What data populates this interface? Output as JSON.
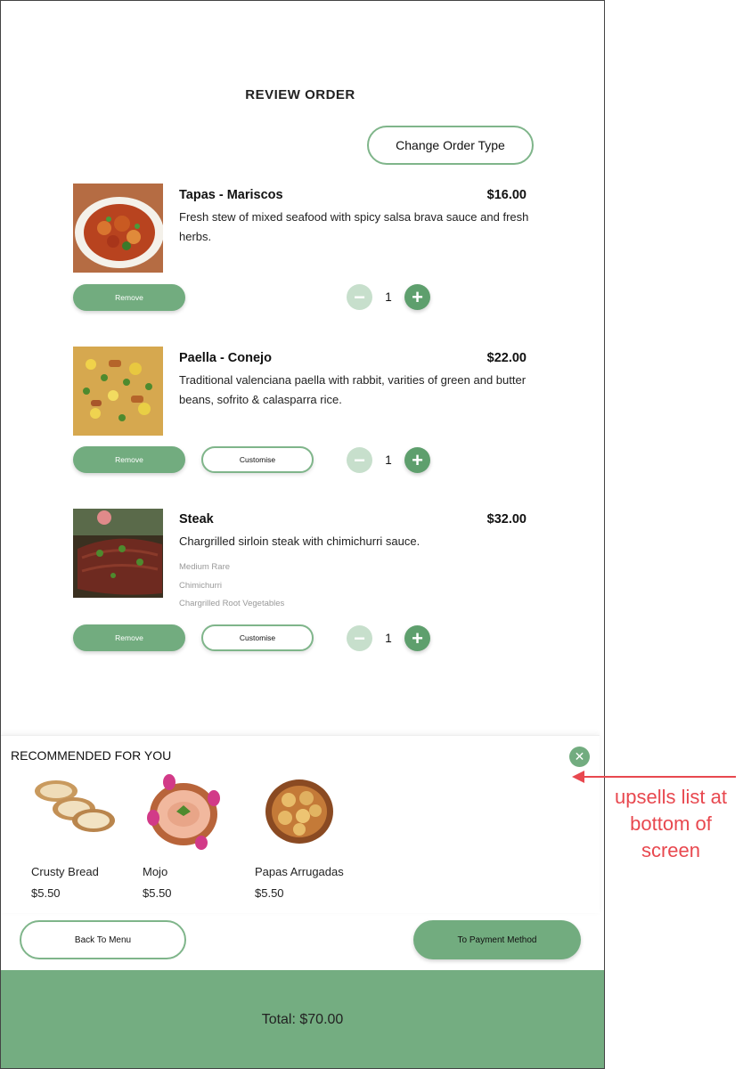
{
  "header": {
    "title": "REVIEW ORDER",
    "change_order_type_label": "Change Order Type"
  },
  "items": [
    {
      "name": "Tapas - Mariscos",
      "price": "$16.00",
      "description": "Fresh stew of mixed seafood with spicy salsa brava sauce and fresh herbs.",
      "remove_label": "Remove",
      "quantity": "1"
    },
    {
      "name": "Paella - Conejo",
      "price": "$22.00",
      "description": "Traditional valenciana paella with rabbit, varities of green and butter beans, sofrito & calasparra rice.",
      "remove_label": "Remove",
      "customise_label": "Customise",
      "quantity": "1"
    },
    {
      "name": "Steak",
      "price": "$32.00",
      "description": "Chargrilled sirloin steak with chimichurri sauce.",
      "modifiers": [
        "Medium Rare",
        "Chimichurri",
        "Chargrilled Root Vegetables"
      ],
      "remove_label": "Remove",
      "customise_label": "Customise",
      "quantity": "1"
    }
  ],
  "recommended": {
    "title": "RECOMMENDED FOR YOU",
    "items": [
      {
        "name": "Crusty Bread",
        "price": "$5.50"
      },
      {
        "name": "Mojo",
        "price": "$5.50"
      },
      {
        "name": "Papas Arrugadas",
        "price": "$5.50"
      }
    ]
  },
  "footer": {
    "back_label": "Back To Menu",
    "pay_label": "To Payment Method",
    "total_label": "Total: $70.00"
  },
  "annotation": {
    "lines": [
      "upsells list at",
      "bottom of",
      "screen"
    ]
  },
  "colors": {
    "accent": "#72ac7f",
    "accent_light": "#c7dfcc",
    "total_bar": "#74ad81",
    "annotation": "#e8484f"
  }
}
